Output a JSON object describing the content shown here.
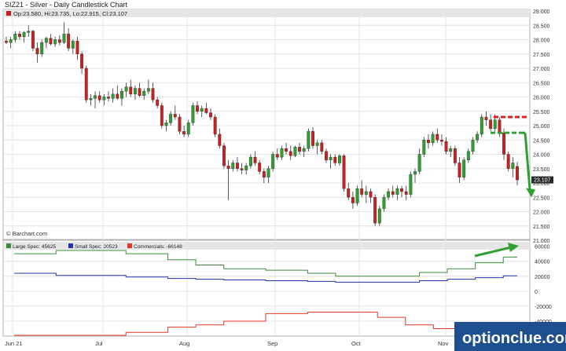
{
  "title": "SIZ21 - Silver - Daily Candlestick Chart",
  "ohlc_legend": "Op:23.580, Hi:23.735, Lo:22.915, Cl:23.107",
  "source": "© Barchart.com",
  "watermark": "optionclue.com",
  "last_price_label": "23.107",
  "colors": {
    "up": "#2ea02e",
    "down": "#cc1f1f",
    "large_spec": "#3b8a3b",
    "small_spec": "#2233aa",
    "commercials": "#e03a2a",
    "annotation_red": "#e02020",
    "annotation_green": "#30a030",
    "last_price_box": "#2a2a2a",
    "watermark_bg": "#1e4f8f"
  },
  "chart_data": [
    {
      "type": "candlestick",
      "title": "SIZ21 - Silver - Daily Candlestick Chart",
      "ylim": [
        21.0,
        29.0
      ],
      "y_ticks": [
        "29.000",
        "28.500",
        "28.000",
        "27.500",
        "27.000",
        "26.500",
        "26.000",
        "25.500",
        "25.000",
        "24.500",
        "24.000",
        "23.500",
        "23.000",
        "22.500",
        "22.000",
        "21.500",
        "21.000"
      ],
      "x_ticks": [
        "Jun 21",
        "Jul",
        "Aug",
        "Sep",
        "Oct",
        "Nov"
      ],
      "last_close": 23.107,
      "annotations": [
        "dashed-resistance-25.30",
        "dashed-level-24.75",
        "down-arrow-to-22.50"
      ],
      "candles": [
        [
          27.95,
          28.1,
          27.85,
          27.9
        ],
        [
          27.9,
          28.1,
          27.7,
          28.0
        ],
        [
          28.0,
          28.3,
          27.9,
          28.2
        ],
        [
          28.2,
          28.3,
          28.0,
          28.1
        ],
        [
          28.1,
          28.3,
          27.9,
          28.25
        ],
        [
          28.25,
          28.5,
          28.1,
          28.3
        ],
        [
          28.3,
          28.35,
          27.6,
          27.7
        ],
        [
          27.7,
          27.9,
          27.2,
          27.5
        ],
        [
          27.5,
          28.0,
          27.4,
          27.9
        ],
        [
          27.9,
          28.1,
          27.7,
          28.05
        ],
        [
          28.05,
          28.2,
          27.8,
          27.85
        ],
        [
          27.85,
          28.1,
          27.75,
          28.0
        ],
        [
          28.0,
          28.15,
          27.8,
          27.9
        ],
        [
          27.9,
          28.6,
          27.85,
          28.2
        ],
        [
          28.2,
          28.4,
          27.6,
          27.7
        ],
        [
          27.7,
          28.0,
          27.5,
          27.95
        ],
        [
          27.95,
          28.1,
          27.3,
          27.5
        ],
        [
          27.5,
          27.6,
          26.8,
          27.0
        ],
        [
          27.0,
          27.1,
          25.8,
          25.9
        ],
        [
          25.9,
          26.1,
          25.7,
          25.95
        ],
        [
          25.95,
          26.2,
          25.6,
          26.05
        ],
        [
          26.05,
          26.2,
          25.8,
          25.9
        ],
        [
          25.9,
          26.1,
          25.7,
          26.0
        ],
        [
          26.0,
          26.2,
          25.85,
          25.95
        ],
        [
          25.95,
          26.3,
          25.8,
          26.1
        ],
        [
          26.1,
          26.4,
          25.9,
          25.95
        ],
        [
          25.95,
          26.3,
          25.7,
          26.2
        ],
        [
          26.2,
          26.5,
          26.0,
          26.35
        ],
        [
          26.35,
          26.6,
          26.0,
          26.1
        ],
        [
          26.1,
          26.4,
          25.9,
          26.3
        ],
        [
          26.3,
          26.5,
          26.0,
          26.05
        ],
        [
          26.05,
          26.3,
          25.9,
          26.2
        ],
        [
          26.2,
          26.6,
          26.1,
          26.3
        ],
        [
          26.3,
          26.5,
          25.8,
          25.9
        ],
        [
          25.9,
          26.0,
          25.6,
          25.7
        ],
        [
          25.7,
          25.8,
          24.9,
          25.0
        ],
        [
          25.0,
          25.2,
          24.8,
          25.1
        ],
        [
          25.1,
          25.5,
          25.0,
          25.4
        ],
        [
          25.4,
          25.7,
          25.2,
          25.3
        ],
        [
          25.3,
          25.4,
          24.7,
          24.8
        ],
        [
          24.8,
          25.0,
          24.6,
          24.7
        ],
        [
          24.7,
          25.2,
          24.6,
          25.1
        ],
        [
          25.1,
          25.8,
          25.0,
          25.7
        ],
        [
          25.7,
          25.85,
          25.4,
          25.5
        ],
        [
          25.5,
          25.7,
          25.3,
          25.6
        ],
        [
          25.6,
          25.8,
          25.4,
          25.45
        ],
        [
          25.45,
          25.6,
          25.2,
          25.3
        ],
        [
          25.3,
          25.4,
          24.6,
          24.7
        ],
        [
          24.7,
          24.9,
          24.2,
          24.3
        ],
        [
          24.3,
          24.4,
          23.5,
          23.6
        ],
        [
          23.6,
          23.8,
          22.4,
          23.5
        ],
        [
          23.5,
          23.8,
          23.4,
          23.7
        ],
        [
          23.7,
          23.9,
          23.4,
          23.5
        ],
        [
          23.5,
          23.7,
          23.3,
          23.45
        ],
        [
          23.45,
          23.7,
          23.3,
          23.6
        ],
        [
          23.6,
          24.0,
          23.5,
          23.9
        ],
        [
          23.9,
          24.1,
          23.6,
          23.7
        ],
        [
          23.7,
          23.8,
          23.3,
          23.4
        ],
        [
          23.4,
          23.5,
          23.0,
          23.2
        ],
        [
          23.2,
          23.6,
          23.0,
          23.5
        ],
        [
          23.5,
          24.1,
          23.4,
          24.0
        ],
        [
          24.0,
          24.2,
          23.8,
          23.9
        ],
        [
          23.9,
          24.3,
          23.8,
          24.2
        ],
        [
          24.2,
          24.4,
          24.0,
          24.1
        ],
        [
          24.1,
          24.3,
          23.8,
          23.95
        ],
        [
          23.95,
          24.3,
          23.9,
          24.25
        ],
        [
          24.25,
          24.4,
          24.0,
          24.1
        ],
        [
          24.1,
          24.3,
          23.9,
          24.2
        ],
        [
          24.2,
          24.9,
          24.1,
          24.8
        ],
        [
          24.8,
          24.95,
          24.2,
          24.3
        ],
        [
          24.3,
          24.5,
          24.0,
          24.4
        ],
        [
          24.4,
          24.5,
          24.0,
          24.1
        ],
        [
          24.1,
          24.2,
          23.7,
          23.8
        ],
        [
          23.8,
          24.0,
          23.5,
          23.9
        ],
        [
          23.9,
          24.0,
          23.6,
          23.7
        ],
        [
          23.7,
          24.0,
          23.6,
          23.95
        ],
        [
          23.95,
          24.0,
          22.7,
          22.8
        ],
        [
          22.8,
          23.0,
          22.4,
          22.5
        ],
        [
          22.5,
          22.7,
          22.1,
          22.3
        ],
        [
          22.3,
          22.9,
          22.2,
          22.8
        ],
        [
          22.8,
          23.1,
          22.5,
          22.6
        ],
        [
          22.6,
          22.9,
          22.3,
          22.7
        ],
        [
          22.7,
          22.8,
          22.3,
          22.5
        ],
        [
          22.5,
          22.6,
          21.5,
          21.6
        ],
        [
          21.6,
          22.2,
          21.5,
          22.1
        ],
        [
          22.1,
          22.6,
          22.0,
          22.5
        ],
        [
          22.5,
          22.8,
          22.4,
          22.7
        ],
        [
          22.7,
          22.9,
          22.5,
          22.6
        ],
        [
          22.6,
          22.9,
          22.4,
          22.8
        ],
        [
          22.8,
          22.9,
          22.5,
          22.7
        ],
        [
          22.7,
          22.9,
          22.4,
          22.6
        ],
        [
          22.6,
          23.4,
          22.5,
          23.3
        ],
        [
          23.3,
          23.5,
          23.0,
          23.4
        ],
        [
          23.4,
          24.2,
          23.3,
          24.0
        ],
        [
          24.0,
          24.6,
          23.9,
          24.5
        ],
        [
          24.5,
          24.7,
          24.2,
          24.4
        ],
        [
          24.4,
          24.8,
          24.3,
          24.7
        ],
        [
          24.7,
          24.9,
          24.4,
          24.5
        ],
        [
          24.5,
          24.7,
          24.3,
          24.45
        ],
        [
          24.45,
          24.6,
          24.0,
          24.1
        ],
        [
          24.1,
          24.3,
          23.9,
          24.2
        ],
        [
          24.2,
          24.3,
          23.6,
          23.7
        ],
        [
          23.7,
          23.9,
          23.0,
          23.2
        ],
        [
          23.2,
          23.9,
          23.1,
          23.8
        ],
        [
          23.8,
          24.2,
          23.7,
          24.1
        ],
        [
          24.1,
          24.6,
          24.0,
          24.5
        ],
        [
          24.5,
          24.8,
          24.4,
          24.7
        ],
        [
          24.7,
          25.4,
          24.6,
          25.3
        ],
        [
          25.3,
          25.5,
          25.0,
          25.2
        ],
        [
          25.2,
          25.4,
          24.8,
          24.9
        ],
        [
          24.9,
          25.4,
          24.8,
          25.2
        ],
        [
          25.2,
          25.3,
          24.6,
          24.75
        ],
        [
          24.75,
          24.9,
          23.8,
          24.0
        ],
        [
          24.0,
          24.1,
          23.4,
          23.5
        ],
        [
          23.5,
          23.9,
          23.2,
          23.7
        ],
        [
          23.58,
          23.735,
          22.915,
          23.107
        ]
      ]
    },
    {
      "type": "line",
      "title": "Commitment of Traders",
      "ylim": [
        -60000,
        68000
      ],
      "y_ticks": [
        "60000",
        "40000",
        "20000",
        "0",
        "-20000",
        "-40000"
      ],
      "series": [
        {
          "name": "Large Spec: 45625",
          "values": [
            50000,
            50000,
            50000,
            57000,
            57000,
            57000,
            57000,
            57000,
            50000,
            50000,
            50000,
            42000,
            42000,
            35000,
            35000,
            30000,
            30000,
            30000,
            28000,
            28000,
            28000,
            24000,
            24000,
            20000,
            20000,
            20000,
            20000,
            20000,
            20000,
            25000,
            25000,
            30000,
            30000,
            38000,
            38000,
            45625,
            45625
          ]
        },
        {
          "name": "Small Spec: 20523",
          "values": [
            24000,
            24000,
            24000,
            21000,
            21000,
            21000,
            21000,
            21000,
            19000,
            19000,
            19000,
            17000,
            17000,
            16000,
            16000,
            15000,
            15000,
            15000,
            14000,
            14000,
            14000,
            13000,
            13000,
            12000,
            12000,
            12000,
            12000,
            12000,
            12000,
            14000,
            14000,
            16000,
            16000,
            18000,
            18000,
            20523,
            20523
          ]
        },
        {
          "name": "Commercials: -66148",
          "values": [
            -72000,
            -72000,
            -72000,
            -60000,
            -60000,
            -60000,
            -60000,
            -60000,
            -55000,
            -55000,
            -55000,
            -48000,
            -48000,
            -45000,
            -45000,
            -40000,
            -40000,
            -40000,
            -30000,
            -30000,
            -30000,
            -28000,
            -28000,
            -28000,
            -28000,
            -28000,
            -35000,
            -35000,
            -45000,
            -45000,
            -50000,
            -50000,
            -55000,
            -55000,
            -60000,
            -66148,
            -66148
          ]
        }
      ]
    }
  ]
}
